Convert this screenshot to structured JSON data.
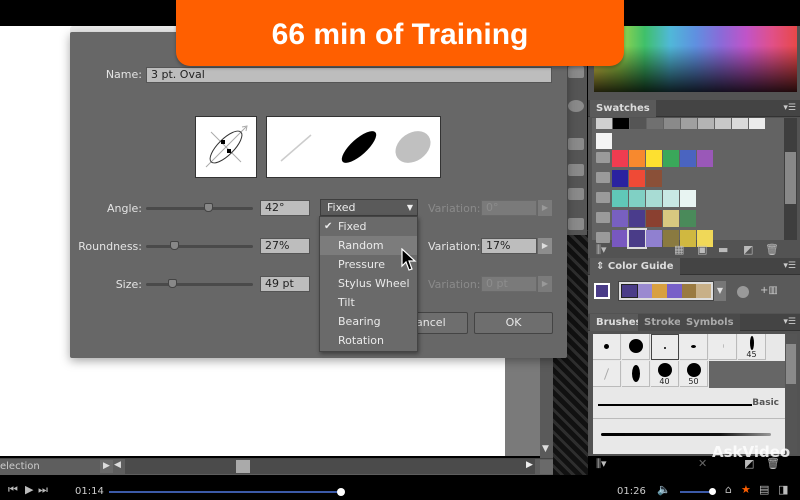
{
  "banner": {
    "text": "66 min of Training"
  },
  "dialog": {
    "name_label": "Name:",
    "name_value": "3 pt. Oval",
    "angle": {
      "label": "Angle:",
      "value": "42°",
      "slider_fraction": 0.6,
      "mode": "Fixed",
      "variation_label": "Variation:",
      "variation_value": "0°",
      "variation_enabled": false
    },
    "roundness": {
      "label": "Roundness:",
      "value": "27%",
      "slider_fraction": 0.27,
      "variation_label": "Variation:",
      "variation_value": "17%",
      "variation_enabled": true
    },
    "size": {
      "label": "Size:",
      "value": "49 pt",
      "slider_fraction": 0.25,
      "variation_label": "Variation:",
      "variation_value": "0 pt",
      "variation_enabled": false
    },
    "cancel_label": "Cancel",
    "ok_label": "OK",
    "dropdown": {
      "selected": "Fixed",
      "highlighted": "Random",
      "options": [
        "Fixed",
        "Random",
        "Pressure",
        "Stylus Wheel",
        "Tilt",
        "Bearing",
        "Rotation"
      ]
    }
  },
  "status_bar": {
    "text": "election"
  },
  "panels": {
    "swatches": {
      "title": "Swatches",
      "rows": [
        [
          "#d0d0d0",
          "#000000",
          "#555555",
          "#707070",
          "#8a8a8a",
          "#a0a0a0",
          "#b4b4b4",
          "#c8c8c8",
          "#dadada",
          "#ececec"
        ],
        [
          "#f4f4f4"
        ],
        [
          "#f03c50",
          "#f7892e",
          "#fde030",
          "#3aa85a",
          "#4a64c0",
          "#9a58b8"
        ],
        [
          "#2a22a0",
          "#ef4a36",
          "#8a5038"
        ],
        [
          "#60c8b8",
          "#80d0c4",
          "#a8dcd4",
          "#c8e8e4",
          "#e8f4f2"
        ],
        [
          "#7860c0",
          "#4a3c8c",
          "#8a4030",
          "#d8c880",
          "#4a8a5a"
        ],
        [
          "#7858c0",
          "#4a3c88",
          "#9080d0",
          "#8a7a40",
          "#d0b840",
          "#f0d858"
        ]
      ]
    },
    "color_guide": {
      "title": "Color Guide",
      "base_color": "#4a3c88",
      "harmony": [
        "#4a3c88",
        "#9a8ad0",
        "#d8a040",
        "#7860c8",
        "#9a7a40",
        "#c8b088"
      ]
    },
    "brushes": {
      "tabs": [
        "Brushes",
        "Stroke",
        "Symbols"
      ],
      "active_tab": "Brushes",
      "brush_labels": [
        "45",
        "40",
        "50"
      ],
      "line_brush_label": "Basic"
    }
  },
  "watermark": "AskVideo",
  "player": {
    "elapsed": "01:14",
    "remaining": "01:26",
    "progress": 0.47,
    "volume": 0.9
  },
  "colors": {
    "accent": "#ff5f00",
    "progress": "#3c5aa8"
  }
}
